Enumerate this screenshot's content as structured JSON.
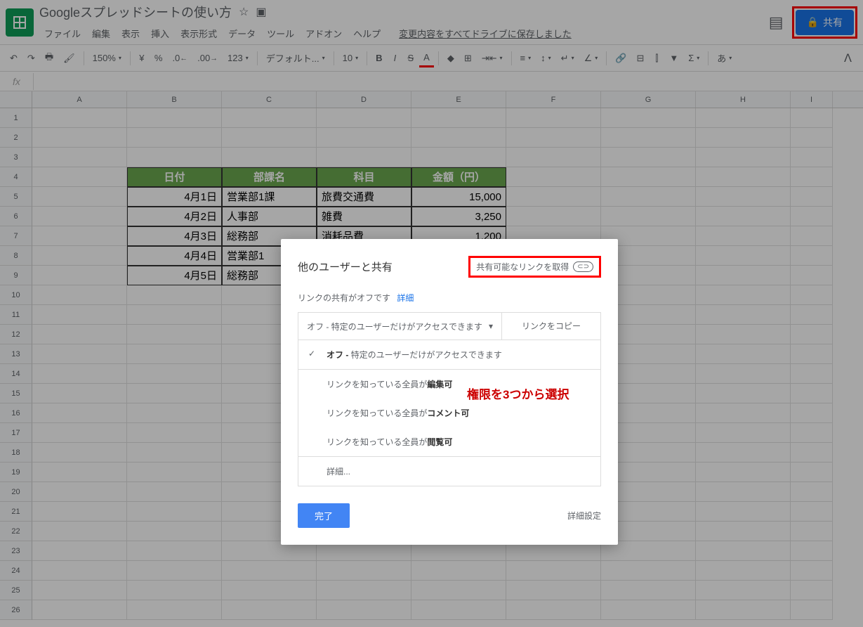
{
  "doc_title": "Googleスプレッドシートの使い方",
  "menus": [
    "ファイル",
    "編集",
    "表示",
    "挿入",
    "表示形式",
    "データ",
    "ツール",
    "アドオン",
    "ヘルプ"
  ],
  "save_status": "変更内容をすべてドライブに保存しました",
  "share_label": "共有",
  "toolbar": {
    "zoom": "150%",
    "currency": "¥",
    "percent": "%",
    "dec_dec": ".0",
    "dec_inc": ".00",
    "format": "123",
    "font": "デフォルト...",
    "size": "10",
    "more_text": "あ"
  },
  "columns": [
    "A",
    "B",
    "C",
    "D",
    "E",
    "F",
    "G",
    "H",
    "I"
  ],
  "row_count": 26,
  "table": {
    "headers": [
      "日付",
      "部課名",
      "科目",
      "金額（円）"
    ],
    "rows": [
      [
        "4月1日",
        "営業部1課",
        "旅費交通費",
        "15,000"
      ],
      [
        "4月2日",
        "人事部",
        "雑費",
        "3,250"
      ],
      [
        "4月3日",
        "総務部",
        "消耗品費",
        "1,200"
      ],
      [
        "4月4日",
        "営業部1",
        "",
        ""
      ],
      [
        "4月5日",
        "総務部",
        "",
        ""
      ]
    ]
  },
  "dialog": {
    "title": "他のユーザーと共有",
    "get_link": "共有可能なリンクを取得",
    "sub_text": "リンクの共有がオフです",
    "sub_link": "詳細",
    "access_dd": "オフ - 特定のユーザーだけがアクセスできます",
    "copy_link": "リンクをコピー",
    "options": {
      "off_pre": "オフ - ",
      "off_rest": "特定のユーザーだけがアクセスできます",
      "edit_pre": "リンクを知っている全員が",
      "edit_bold": "編集可",
      "comment_pre": "リンクを知っている全員が",
      "comment_bold": "コメント可",
      "view_pre": "リンクを知っている全員が",
      "view_bold": "閲覧可",
      "more": "詳細..."
    },
    "done": "完了",
    "advanced": "詳細設定"
  },
  "annotation": "権限を3つから選択"
}
